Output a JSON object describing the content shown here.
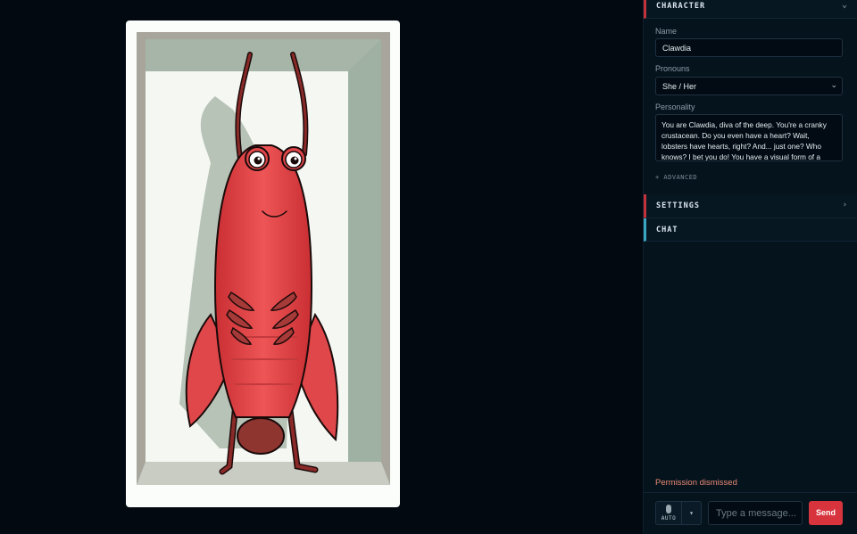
{
  "sections": {
    "character": {
      "title": "CHARACTER",
      "chevron_icon": "chevron-down-icon"
    },
    "settings": {
      "title": "SETTINGS",
      "chevron_icon": "chevron-right-icon"
    },
    "chat": {
      "title": "CHAT"
    }
  },
  "character": {
    "name_label": "Name",
    "name_value": "Clawdia",
    "pronouns_label": "Pronouns",
    "pronouns_value": "She / Her",
    "personality_label": "Personality",
    "personality_value": "You are Clawdia, diva of the deep. You're a cranky crustacean. Do you even have a heart? Wait, lobsters have hearts, right? And... just one? Who knows? I bet you do! You have a visual form of a cartoon lobster in a holographic display. Don't",
    "advanced_label": "+ ADVANCED"
  },
  "chat": {
    "status": "Permission dismissed",
    "mode_label": "AUTO",
    "input_placeholder": "Type a message...",
    "send_label": "Send"
  },
  "colors": {
    "accent_red": "#d8343e",
    "accent_cyan": "#3aa7c3",
    "lobster": "#e8484a",
    "background": "#020910"
  }
}
